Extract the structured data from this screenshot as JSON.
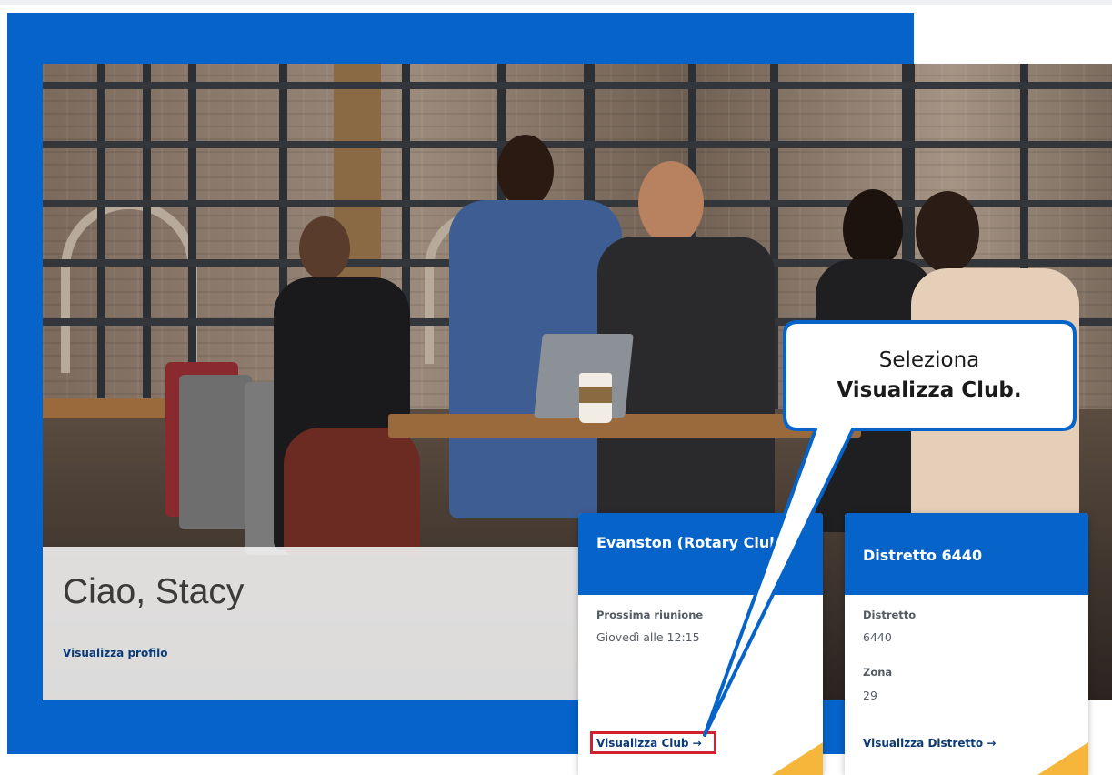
{
  "greeting": {
    "title": "Ciao, Stacy",
    "profile_link": "Visualizza profilo"
  },
  "club_card": {
    "title": "Evanston (Rotary Club)",
    "meeting_label": "Prossima riunione",
    "meeting_value": "Giovedì alle 12:15",
    "link": "Visualizza Club →"
  },
  "district_card": {
    "title": "Distretto 6440",
    "district_label": "Distretto",
    "district_value": "6440",
    "zone_label": "Zona",
    "zone_value": "29",
    "link": "Visualizza Distretto →"
  },
  "callout": {
    "line1": "Seleziona",
    "line2": "Visualizza Club."
  },
  "colors": {
    "primary_blue": "#0563c9",
    "link_navy": "#0b3a78",
    "highlight_red": "#d3202e",
    "accent_gold": "#f6b53b"
  }
}
